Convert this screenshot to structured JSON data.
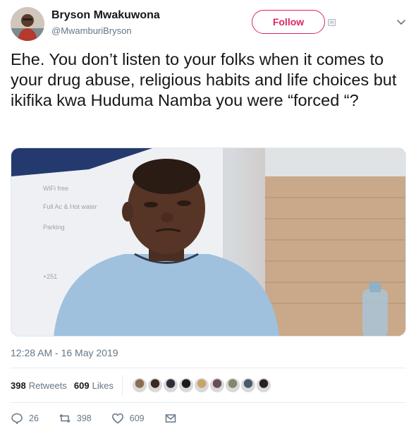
{
  "author": {
    "name": "Bryson Mwakuwona",
    "handle": "@MwamburiBryson"
  },
  "follow_button": {
    "label": "Follow"
  },
  "icons": {
    "caret": "chevron-down-icon",
    "reply": "reply-icon",
    "retweet": "retweet-icon",
    "like": "heart-icon",
    "dm": "envelope-icon"
  },
  "tweet": {
    "text": "Ehe. You don’t listen to your folks when it comes to your drug abuse, religious habits and life choices but ikifika kwa Huduma Namba you were “forced “?",
    "timestamp": "12:28 AM - 16 May 2019"
  },
  "stats": {
    "retweets": "398",
    "retweets_label": "Retweets",
    "likes": "609",
    "likes_label": "Likes"
  },
  "actions": {
    "reply_count": "26",
    "retweet_count": "398",
    "like_count": "609"
  },
  "likers": [
    {
      "color": "#8a6d4f"
    },
    {
      "color": "#3a2a22"
    },
    {
      "color": "#2b2f3a"
    },
    {
      "color": "#1c1c1c"
    },
    {
      "color": "#c9a46a"
    },
    {
      "color": "#6b4c5a"
    },
    {
      "color": "#7f8a6a"
    },
    {
      "color": "#4a5a6a"
    },
    {
      "color": "#2a2020"
    }
  ],
  "colors": {
    "follow_accent": "#e0245e",
    "secondary_text": "#657786",
    "primary_text": "#14171a"
  },
  "media_sign_text": [
    "WiFi free",
    "Full Ac & Hot water",
    "Parking",
    "+251"
  ]
}
